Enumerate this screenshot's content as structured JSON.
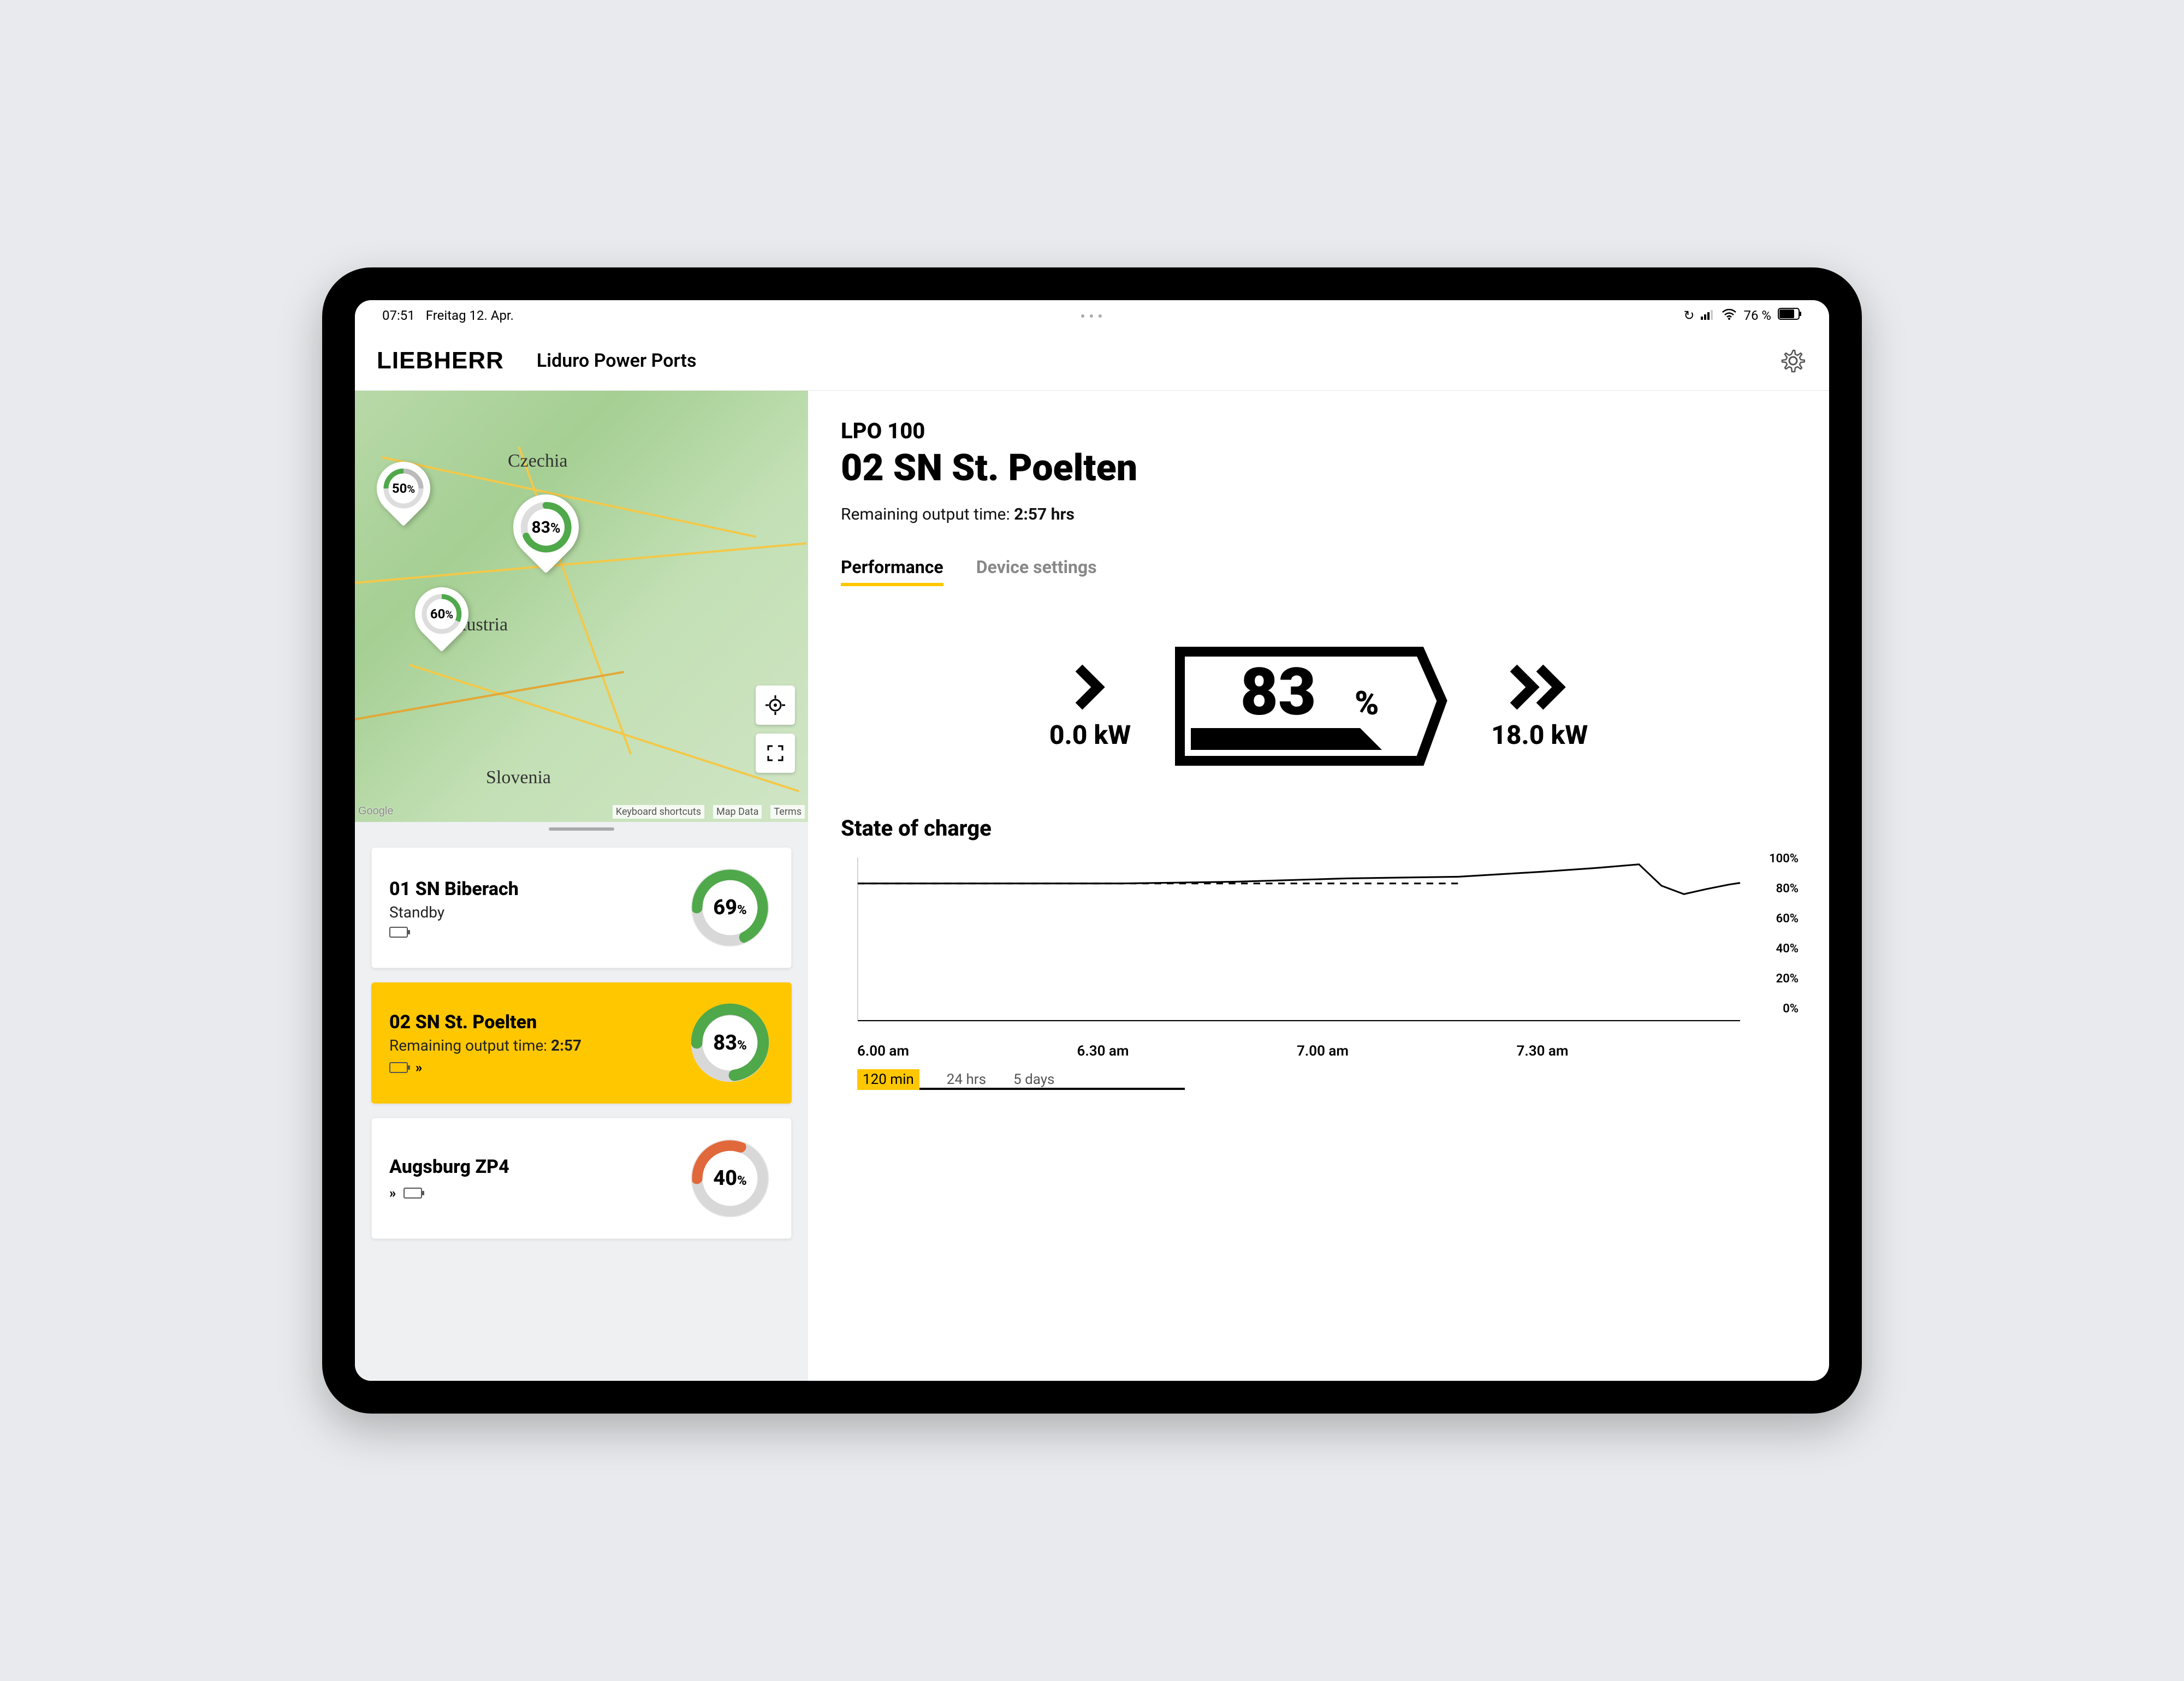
{
  "status_bar": {
    "time": "07:51",
    "date": "Freitag 12. Apr.",
    "battery_text": "76 %"
  },
  "header": {
    "brand": "LIEBHERR",
    "app_title": "Liduro Power Ports"
  },
  "map": {
    "labels": {
      "czechia": "Czechia",
      "austria": "Austria",
      "slovenia": "Slovenia"
    },
    "pins": [
      {
        "value": "50",
        "unit": "%",
        "ring_color": "#4fa84a"
      },
      {
        "value": "83",
        "unit": "%",
        "ring_color": "#4fa84a"
      },
      {
        "value": "60",
        "unit": "%",
        "ring_color": "#4fa84a"
      }
    ],
    "attribution": {
      "google": "Google",
      "shortcuts": "Keyboard shortcuts",
      "mapdata": "Map Data",
      "terms": "Terms"
    }
  },
  "devices": [
    {
      "name": "01 SN Biberach",
      "status_label": "Standby",
      "status_value": "",
      "gauge_value": "69",
      "gauge_unit": "%",
      "gauge_color": "#4fa84a",
      "selected": false,
      "icons": [
        "battery"
      ]
    },
    {
      "name": "02 SN St. Poelten",
      "status_label": "Remaining output time: ",
      "status_value": "2:57",
      "gauge_value": "83",
      "gauge_unit": "%",
      "gauge_color": "#4fa84a",
      "selected": true,
      "icons": [
        "battery",
        "dchev"
      ]
    },
    {
      "name": "Augsburg ZP4",
      "status_label": "",
      "status_value": "",
      "gauge_value": "40",
      "gauge_unit": "%",
      "gauge_color": "#e0683a",
      "selected": false,
      "icons": [
        "dchev",
        "battery"
      ]
    }
  ],
  "detail": {
    "subtitle": "LPO 100",
    "title": "02 SN St. Poelten",
    "meta_label": "Remaining output time: ",
    "meta_value": "2:57 hrs",
    "tabs": {
      "performance": "Performance",
      "settings": "Device settings"
    },
    "perf": {
      "input_kw": "0.0 kW",
      "output_kw": "18.0 kW",
      "soc_value": "83",
      "soc_unit": "%"
    },
    "chart_title": "State of charge",
    "range": {
      "r1": "120 min",
      "r2": "24 hrs",
      "r3": "5 days"
    }
  },
  "chart_data": {
    "type": "line",
    "title": "State of charge",
    "xlabel": "",
    "ylabel": "",
    "ylim": [
      0,
      100
    ],
    "x_ticks": [
      "6.00 am",
      "6.30 am",
      "7.00 am",
      "7.30 am"
    ],
    "y_ticks": [
      "100%",
      "80%",
      "60%",
      "40%",
      "20%",
      "0%"
    ],
    "series": [
      {
        "name": "State of charge",
        "x": [
          "6.00",
          "6.10",
          "6.20",
          "6.30",
          "6.40",
          "6.50",
          "7.00",
          "7.10",
          "7.20",
          "7.25",
          "7.30",
          "7.35",
          "7.40",
          "7.45",
          "7.50"
        ],
        "values": [
          84,
          84,
          84,
          84,
          84,
          85,
          86,
          87,
          89,
          91,
          93,
          89,
          80,
          82,
          83
        ]
      }
    ],
    "reference_line": 84
  }
}
